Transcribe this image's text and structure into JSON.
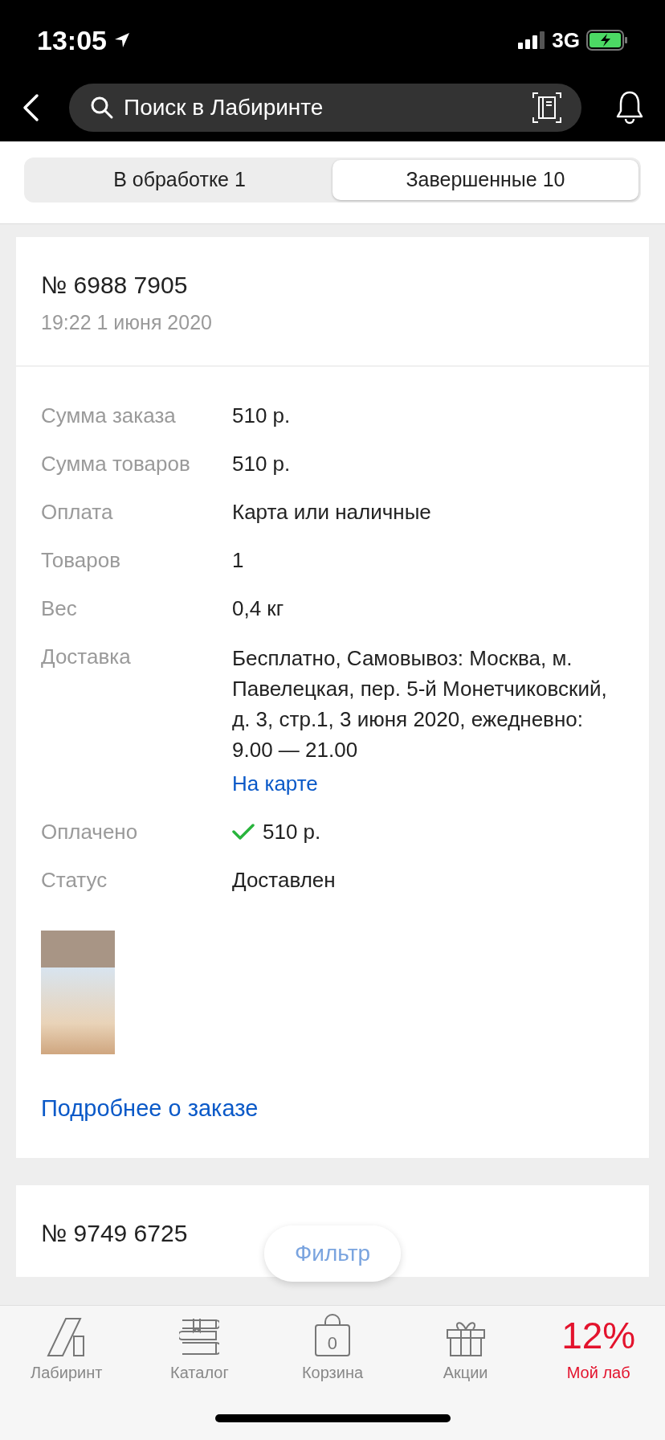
{
  "status_bar": {
    "time": "13:05",
    "network": "3G",
    "battery_charging": true
  },
  "nav": {
    "search_placeholder": "Поиск в Лабиринте"
  },
  "tabs": [
    {
      "label": "В обработке 1",
      "selected": false
    },
    {
      "label": "Завершенные 10",
      "selected": true
    }
  ],
  "orders": [
    {
      "number": "№ 6988 7905",
      "date": "19:22 1 июня 2020",
      "details": [
        {
          "kind": "text",
          "label": "Сумма заказа",
          "value": "510 р."
        },
        {
          "kind": "text",
          "label": "Сумма товаров",
          "value": "510 р."
        },
        {
          "kind": "text",
          "label": "Оплата",
          "value": "Карта или наличные"
        },
        {
          "kind": "text",
          "label": "Товаров",
          "value": "1"
        },
        {
          "kind": "text",
          "label": "Вес",
          "value": "0,4 кг"
        },
        {
          "kind": "delivery",
          "label": "Доставка",
          "value": "Бесплатно, Самовывоз: Москва, м. Павелецкая, пер. 5-й Монетчиковский, д. 3, стр.1, 3 июня 2020, ежедневно: 9.00 — 21.00",
          "link": "На карте"
        },
        {
          "kind": "paid",
          "label": "Оплачено",
          "value": "510 р."
        },
        {
          "kind": "text",
          "label": "Статус",
          "value": "Доставлен"
        }
      ],
      "more_link": "Подробнее о заказе"
    },
    {
      "number": "№ 9749 6725"
    }
  ],
  "filter_button": "Фильтр",
  "tab_bar": [
    {
      "kind": "logo",
      "label": "Лабиринт"
    },
    {
      "kind": "books",
      "label": "Каталог"
    },
    {
      "kind": "bag",
      "label": "Корзина",
      "badge": "0"
    },
    {
      "kind": "gift",
      "label": "Акции"
    },
    {
      "kind": "percent",
      "label": "Мой лаб",
      "value": "12%"
    }
  ]
}
